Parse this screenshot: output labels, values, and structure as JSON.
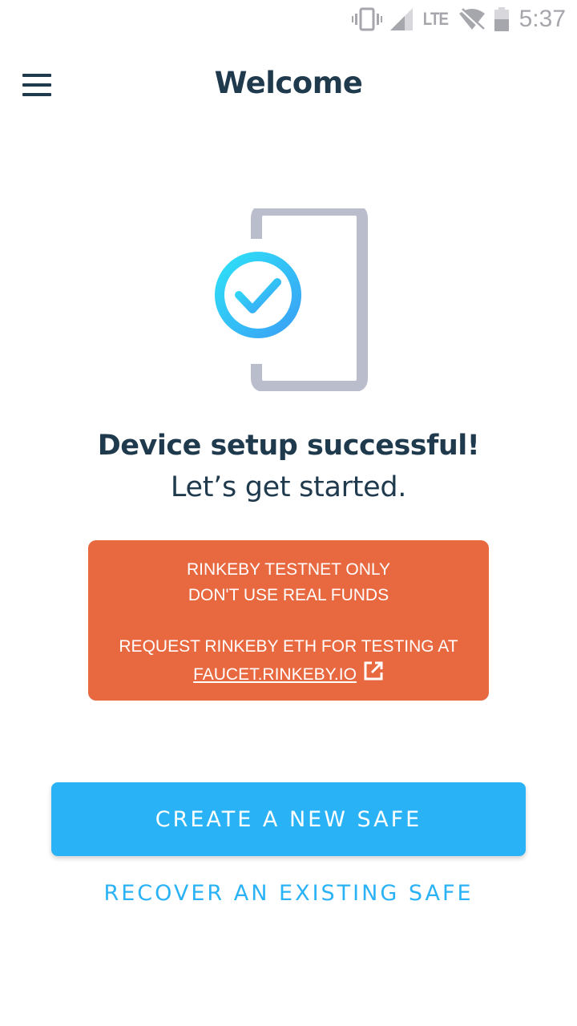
{
  "status_bar": {
    "network_type": "LTE",
    "time": "5:37",
    "icons": [
      "vibrate-icon",
      "signal-icon",
      "wifi-off-icon",
      "battery-icon"
    ]
  },
  "app_bar": {
    "menu_icon": "hamburger-menu-icon",
    "title": "Welcome"
  },
  "illustration": {
    "icons": [
      "phone-outline-icon",
      "check-circle-icon"
    ],
    "colors": {
      "phone": "#b9bdcc",
      "check_start": "#2ee0f7",
      "check_end": "#3aa0f5"
    }
  },
  "message": {
    "headline": "Device setup successful!",
    "subline": "Let’s get started."
  },
  "warning": {
    "line1": "RINKEBY TESTNET ONLY",
    "line2": "DON'T USE REAL FUNDS",
    "line3": "REQUEST RINKEBY ETH FOR TESTING AT",
    "link_text": "FAUCET.RINKEBY.IO",
    "link_icon": "external-link-icon",
    "background": "#e8683f"
  },
  "actions": {
    "create_label": "CREATE A NEW SAFE",
    "recover_label": "RECOVER AN EXISTING SAFE",
    "accent": "#2ab2f6"
  }
}
